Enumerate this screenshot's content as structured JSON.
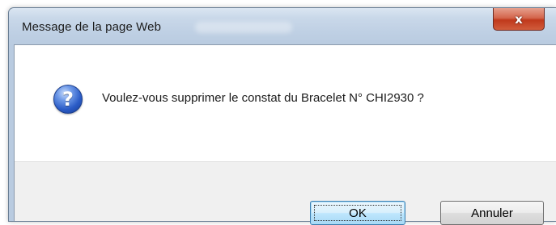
{
  "window": {
    "title": "Message de la page Web",
    "close_symbol": "x"
  },
  "dialog": {
    "icon": "question-icon",
    "icon_glyph": "?",
    "message": "Voulez-vous supprimer le constat du Bracelet N° CHI2930 ?"
  },
  "buttons": {
    "ok_label": "OK",
    "cancel_label": "Annuler"
  },
  "colors": {
    "titlebar": "#c9d8e9",
    "close_button": "#c0391c",
    "footer": "#f0f0f0",
    "default_button_border": "#3c7fb1"
  }
}
